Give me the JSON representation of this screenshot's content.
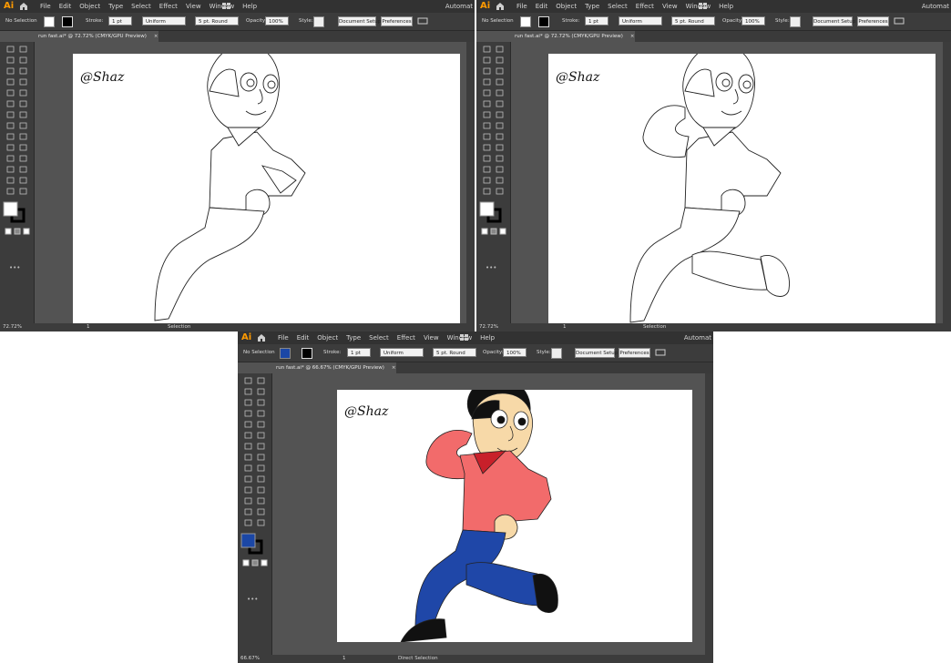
{
  "app": {
    "logo": "Ai",
    "auto_label": "Automat"
  },
  "menu": [
    "File",
    "Edit",
    "Object",
    "Type",
    "Select",
    "Effect",
    "View",
    "Window",
    "Help"
  ],
  "control_bar": {
    "selection_label": "No Selection",
    "stroke_label": "Stroke:",
    "stroke_weight": "1 pt",
    "uniform_label": "Uniform",
    "brush_label": "5 pt. Round",
    "opacity_label": "Opacity:",
    "opacity_value": "100%",
    "style_label": "Style:",
    "doc_setup": "Document Setup",
    "preferences": "Preferences"
  },
  "windows": [
    {
      "id": "win1",
      "doc_tab": "run fast.ai* @ 72.72% (CMYK/GPU Preview)",
      "zoom": "72.72%",
      "page": "1",
      "tool": "Selection",
      "fill_color": "#ffffff",
      "mode": "outline-1"
    },
    {
      "id": "win2",
      "doc_tab": "run fast.ai* @ 72.72% (CMYK/GPU Preview)",
      "zoom": "72.72%",
      "page": "1",
      "tool": "Selection",
      "fill_color": "#ffffff",
      "mode": "outline-2"
    },
    {
      "id": "win3",
      "doc_tab": "run fast.ai* @ 66.67% (CMYK/GPU Preview)",
      "zoom": "66.67%",
      "page": "1",
      "tool": "Direct Selection",
      "fill_color": "#1b47a6",
      "mode": "color"
    }
  ],
  "colors": {
    "shirt": "#f26b6b",
    "collar": "#c8202a",
    "pants": "#1f47a8",
    "hair": "#111111",
    "skin": "#f7d9a8",
    "shoe": "#111111",
    "ui_dark": "#323232",
    "ui_panel": "#3c3c3c",
    "ui_bg": "#535353"
  },
  "artwork": {
    "signature": "@Shaz"
  }
}
